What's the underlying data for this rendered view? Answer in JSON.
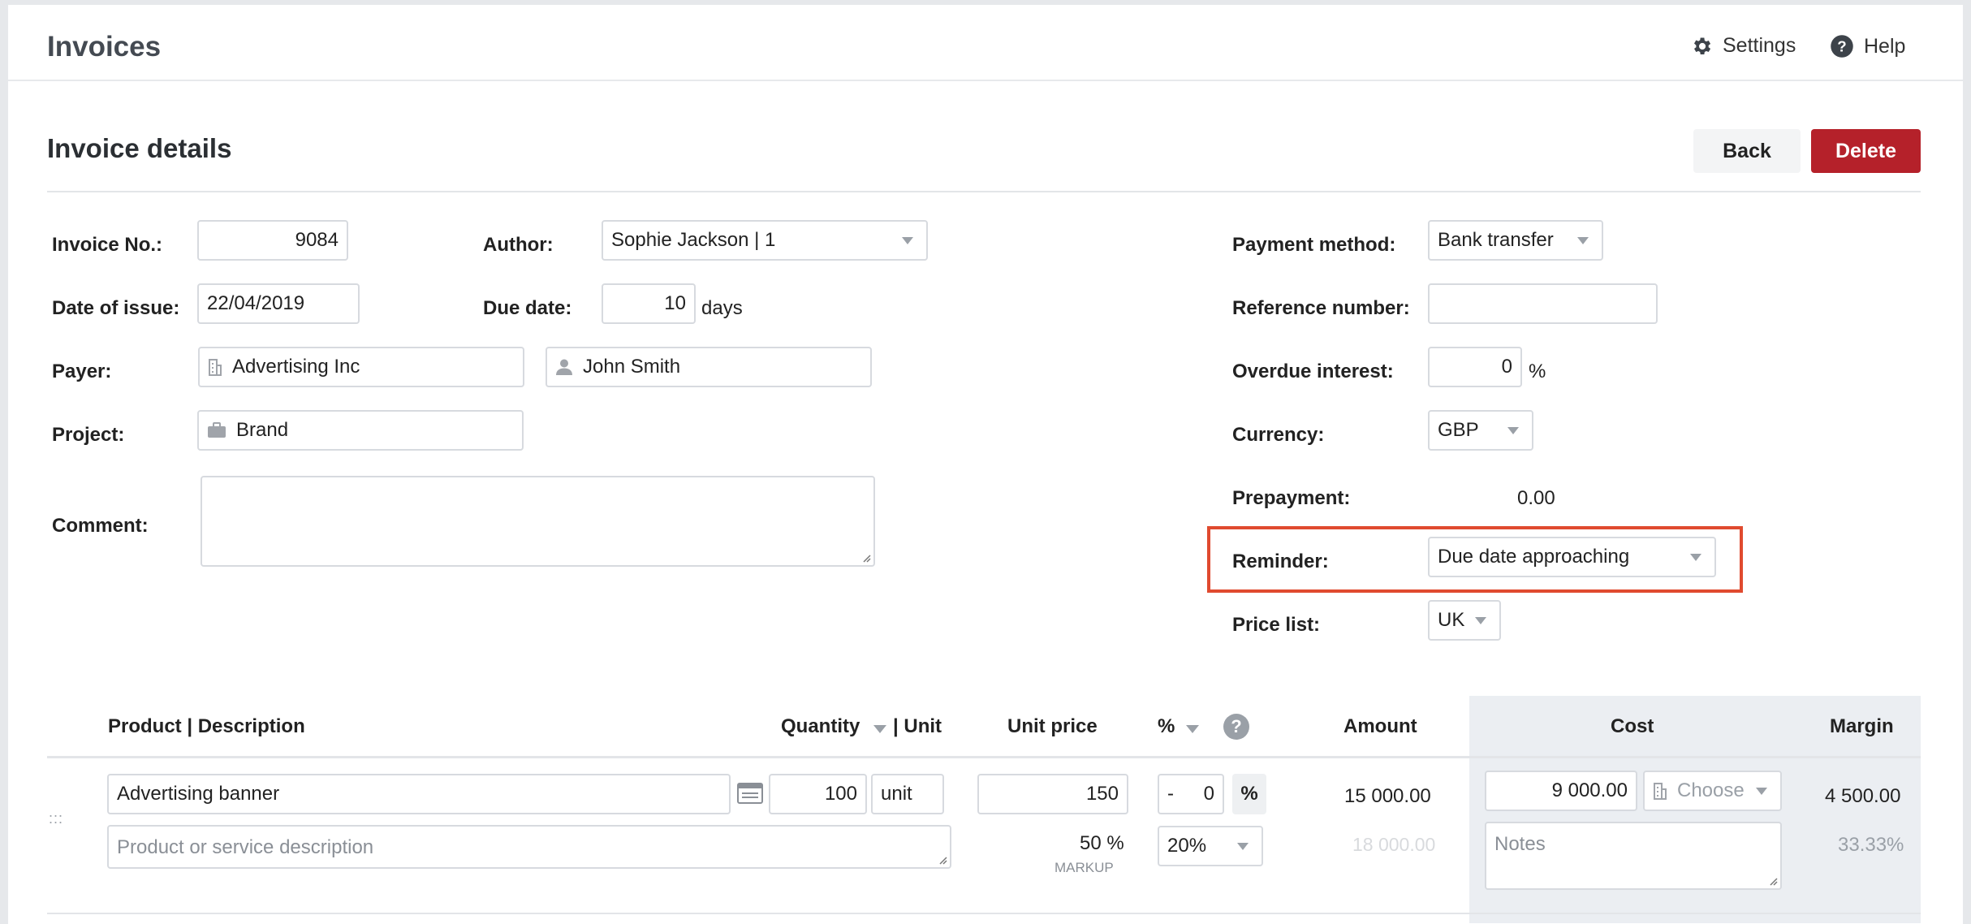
{
  "app": {
    "title": "Invoices",
    "settings_label": "Settings",
    "help_label": "Help"
  },
  "page": {
    "title": "Invoice details",
    "back_label": "Back",
    "delete_label": "Delete"
  },
  "colors": {
    "accent_danger": "#b5212a",
    "highlight": "#e04a2f"
  },
  "form": {
    "invoice_no": {
      "label": "Invoice No.:",
      "value": "9084"
    },
    "author": {
      "label": "Author:",
      "value": "Sophie Jackson | 1"
    },
    "date_of_issue": {
      "label": "Date of issue:",
      "value": "22/04/2019"
    },
    "due_date": {
      "label": "Due date:",
      "value": "10",
      "unit": "days"
    },
    "payer": {
      "label": "Payer:",
      "company": "Advertising Inc",
      "person": "John Smith"
    },
    "project": {
      "label": "Project:",
      "value": "Brand"
    },
    "comment": {
      "label": "Comment:",
      "value": ""
    },
    "payment_method": {
      "label": "Payment method:",
      "value": "Bank transfer"
    },
    "reference_number": {
      "label": "Reference number:",
      "value": ""
    },
    "overdue_interest": {
      "label": "Overdue interest:",
      "value": "0",
      "unit": "%"
    },
    "currency": {
      "label": "Currency:",
      "value": "GBP"
    },
    "prepayment": {
      "label": "Prepayment:",
      "value": "0.00"
    },
    "reminder": {
      "label": "Reminder:",
      "value": "Due date approaching"
    },
    "price_list": {
      "label": "Price list:",
      "value": "UK"
    }
  },
  "table": {
    "headers": {
      "product": "Product | Description",
      "quantity": "Quantity",
      "unit": "| Unit",
      "unit_price": "Unit price",
      "percent": "%",
      "help": "?",
      "amount": "Amount",
      "cost": "Cost",
      "margin": "Margin"
    },
    "row": {
      "handle": ":::",
      "product": "Advertising banner",
      "description_placeholder": "Product or service description",
      "quantity": "100",
      "unit": "unit",
      "unit_price": "150",
      "discount_sign": "-",
      "discount_value": "0",
      "discount_unit": "%",
      "amount": "15 000.00",
      "markup_value": "50 %",
      "markup_label": "MARKUP",
      "vat": "20%",
      "amount_with_vat": "18 000.00",
      "cost": "9 000.00",
      "cost_choose": "Choose",
      "notes_placeholder": "Notes",
      "margin": "4 500.00",
      "margin_percent": "33.33%"
    }
  }
}
